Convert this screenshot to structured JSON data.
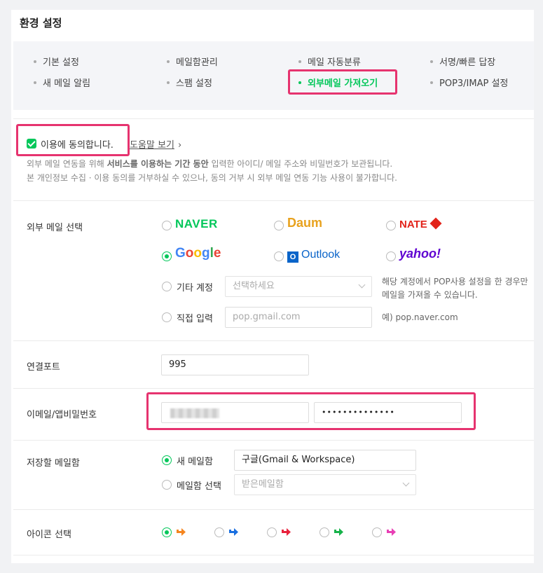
{
  "title": "환경 설정",
  "menu": {
    "items": [
      {
        "label": "기본 설정"
      },
      {
        "label": "메일함관리"
      },
      {
        "label": "메일 자동분류"
      },
      {
        "label": "서명/빠른 답장"
      },
      {
        "label": "새 메일 알림"
      },
      {
        "label": "스팸 설정"
      },
      {
        "label": "외부메일 가져오기",
        "active": true
      },
      {
        "label": "POP3/IMAP 설정"
      }
    ]
  },
  "consent": {
    "checked": true,
    "label": "이용에 동의합니다.",
    "help_link": "도움말 보기",
    "notice_line1_a": "외부 메일 연동을 위해 ",
    "notice_line1_b": "서비스를 이용하는 기간 동안",
    "notice_line1_c": " 입력한 아이디/ 메일 주소와 비밀번호가 보관됩니다.",
    "notice_line2": "본 개인정보 수집 · 이용 동의를 거부하실 수 있으나, 동의 거부 시 외부 메일 연동 기능 사용이 불가합니다."
  },
  "external_mail": {
    "label": "외부 메일 선택",
    "providers": {
      "naver": "NAVER",
      "daum": "Daum",
      "nate": "NATE",
      "google": "Google",
      "outlook": "Outlook",
      "yahoo": "yahoo!"
    },
    "selected": "Google",
    "other_account_label": "기타 계정",
    "other_account_placeholder": "선택하세요",
    "other_account_hint": "해당 계정에서 POP사용 설정을 한 경우만 메일을 가져올 수 있습니다.",
    "direct_input_label": "직접 입력",
    "direct_input_placeholder": "pop.gmail.com",
    "direct_input_example": "예) pop.naver.com"
  },
  "port": {
    "label": "연결포트",
    "value": "995"
  },
  "credentials": {
    "label": "이메일/앱비밀번호",
    "password_value": "••••••••••••••"
  },
  "save_folder": {
    "label": "저장할 메일함",
    "new_folder_label": "새 메일함",
    "new_folder_value": "구글(Gmail & Workspace)",
    "select_folder_label": "메일함 선택",
    "select_folder_placeholder": "받은메일함",
    "selected": "새 메일함"
  },
  "icon_select": {
    "label": "아이콘 선택",
    "icons": [
      {
        "name": "orange-arrow-icon",
        "color": "#f5851f",
        "selected": true
      },
      {
        "name": "blue-arrow-icon",
        "color": "#1a6fe0",
        "selected": false
      },
      {
        "name": "red-arrow-icon",
        "color": "#e8223c",
        "selected": false
      },
      {
        "name": "green-arrow-icon",
        "color": "#17b34a",
        "selected": false
      },
      {
        "name": "pink-arrow-icon",
        "color": "#e83fb5",
        "selected": false
      }
    ]
  },
  "colors": {
    "accent": "#03c75a",
    "highlight": "#e6336f"
  }
}
